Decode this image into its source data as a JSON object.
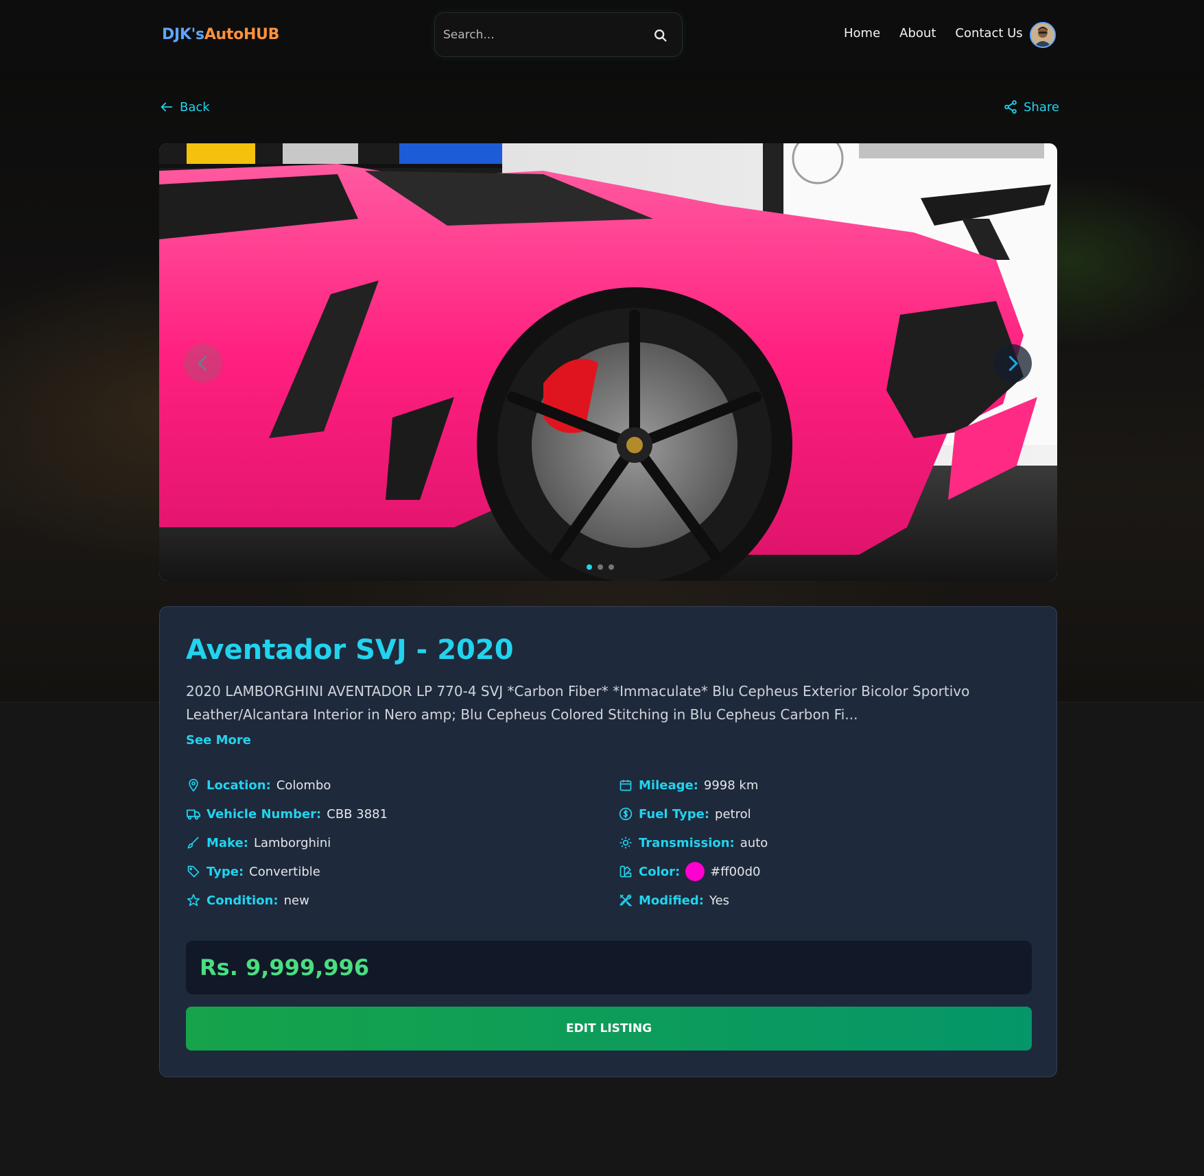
{
  "brand": {
    "part1": "DJK's",
    "part2": "AutoHUB"
  },
  "search": {
    "placeholder": "Search..."
  },
  "nav": {
    "home": "Home",
    "about": "About",
    "contact": "Contact Us"
  },
  "actions": {
    "back": "Back",
    "share": "Share"
  },
  "listing": {
    "title": "Aventador SVJ - 2020",
    "description": "2020 LAMBORGHINI AVENTADOR LP 770-4 SVJ *Carbon Fiber* *Immaculate* Blu Cepheus Exterior Bicolor Sportivo Leather/Alcantara Interior in Nero amp; Blu Cepheus Colored Stitching in Blu Cepheus Carbon Fi...",
    "see_more": "See More",
    "specs": {
      "location": {
        "label": "Location:",
        "value": "Colombo"
      },
      "vehicle_number": {
        "label": "Vehicle Number:",
        "value": "CBB 3881"
      },
      "make": {
        "label": "Make:",
        "value": "Lamborghini"
      },
      "type": {
        "label": "Type:",
        "value": "Convertible"
      },
      "condition": {
        "label": "Condition:",
        "value": "new"
      },
      "mileage": {
        "label": "Mileage:",
        "value": "9998 km"
      },
      "fuel_type": {
        "label": "Fuel Type:",
        "value": "petrol"
      },
      "transmission": {
        "label": "Transmission:",
        "value": "auto"
      },
      "color": {
        "label": "Color:",
        "value": "#ff00d0",
        "swatch": "#ff00d0"
      },
      "modified": {
        "label": "Modified:",
        "value": "Yes"
      }
    },
    "price": "Rs. 9,999,996",
    "edit_button": "EDIT LISTING"
  },
  "carousel": {
    "total_images": 3,
    "active_index": 0
  },
  "colors": {
    "accent": "#22d3ee",
    "price": "#4ade80",
    "button": "#16a34a",
    "card": "#1e293b"
  }
}
